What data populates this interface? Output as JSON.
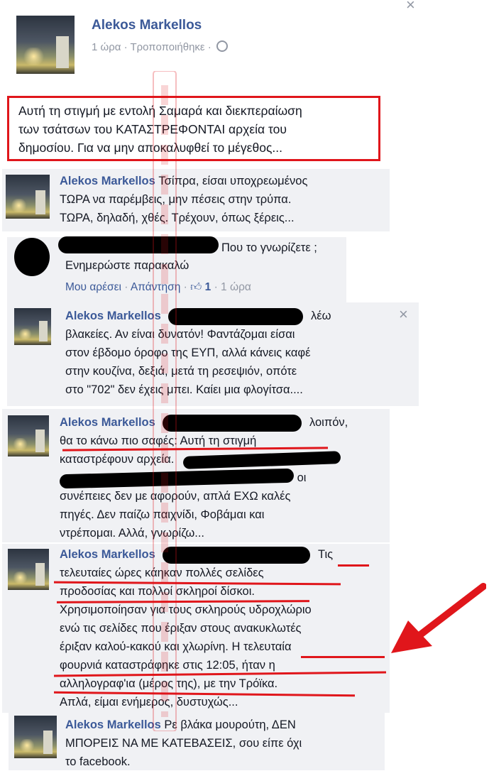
{
  "window": {
    "close_glyph": "×"
  },
  "post": {
    "author": "Alekos Markellos",
    "meta": "1 ώρα · Τροποποιήθηκε ·",
    "text_lines": [
      "Αυτή τη στιγμή με εντολή Σαμαρά και διεκπεραίωση",
      "των τσάτσων του ΚΑΤΑΣΤΡΕΦΟΝΤΑΙ αρχεία του",
      "δημοσίου. Για να μην αποκαλυφθεί το μέγεθος..."
    ]
  },
  "comments": [
    {
      "author": "Alekos Markellos",
      "lines": [
        "Τσίπρα, είσαι υποχρεωμένος",
        "ΤΩΡΑ να παρέμβεις, μην πέσεις στην τρύπα.",
        "ΤΩΡΑ, δηλαδή, χθές. Τρέχουν, όπως ξέρεις..."
      ]
    },
    {
      "lines": [
        "Που το γνωρίζετε ;",
        "Ενημερώστε παρακαλώ"
      ],
      "like": "Μου αρέσει",
      "reply": "Απάντηση",
      "likes_count": "1",
      "time": "1 ώρα"
    },
    {
      "author": "Alekos Markellos",
      "lines": [
        "λέω",
        "βλακείες. Αν είναι δυνατόν! Φαντάζομαι είσαι",
        "στον έβδομο όροφο της ΕΥΠ, αλλά κάνεις καφέ",
        "στην κουζίνα, δεξιά, μετά τη ρεσεψιόν, οπότε",
        "στο \"702\" δεν έχεις μπει. Καίει μια φλογίτσα...."
      ],
      "close_glyph": "×"
    },
    {
      "author": "Alekos Markellos",
      "lines": [
        "λοιπόν,",
        "θα το κάνω πιο σαφές: Αυτή τη στιγμή",
        "καταστρέφουν αρχεία.",
        "οι",
        "συνέπειες δεν με αφορούν, απλά ΕΧΩ καλές",
        "πηγές. Δεν παίζω παιχνίδι, Φοβάμαι και",
        "ντρέπομαι. Αλλά, γνωρίζω..."
      ]
    },
    {
      "author": "Alekos Markellos",
      "lines": [
        "Τις",
        "τελευταίες ώρες κάηκαν πολλές σελίδες",
        "προδοσίας και πολλοί σκληροί δίσκοι.",
        "Χρησιμοποίησαν για τους σκληρούς υδροχλώριο",
        "ενώ τις σελίδες που έριξαν στους ανακυκλωτές",
        "έριξαν καλού-κακού και χλωρίνη. Η τελευταία",
        "φουρνιά καταστράφηκε στις 12:05, ήταν η",
        "αλληλογραφ'ια (μέρος της), με την Τρόϊκα.",
        "Απλά, είμαι ενήμερος, δυστυχώς..."
      ]
    },
    {
      "author": "Alekos Markellos",
      "lines": [
        "Ρε βλάκα μουρούτη, ΔΕΝ",
        "ΜΠΟΡΕΙΣ ΝΑ ΜΕ ΚΑΤΕΒΑΣΕΙΣ, σου είπε όχι",
        "το facebook."
      ]
    }
  ],
  "colors": {
    "link": "#3b5998",
    "meta": "#9197a3",
    "highlight": "#e0161b",
    "comment_bg": "#f0f1f4"
  }
}
